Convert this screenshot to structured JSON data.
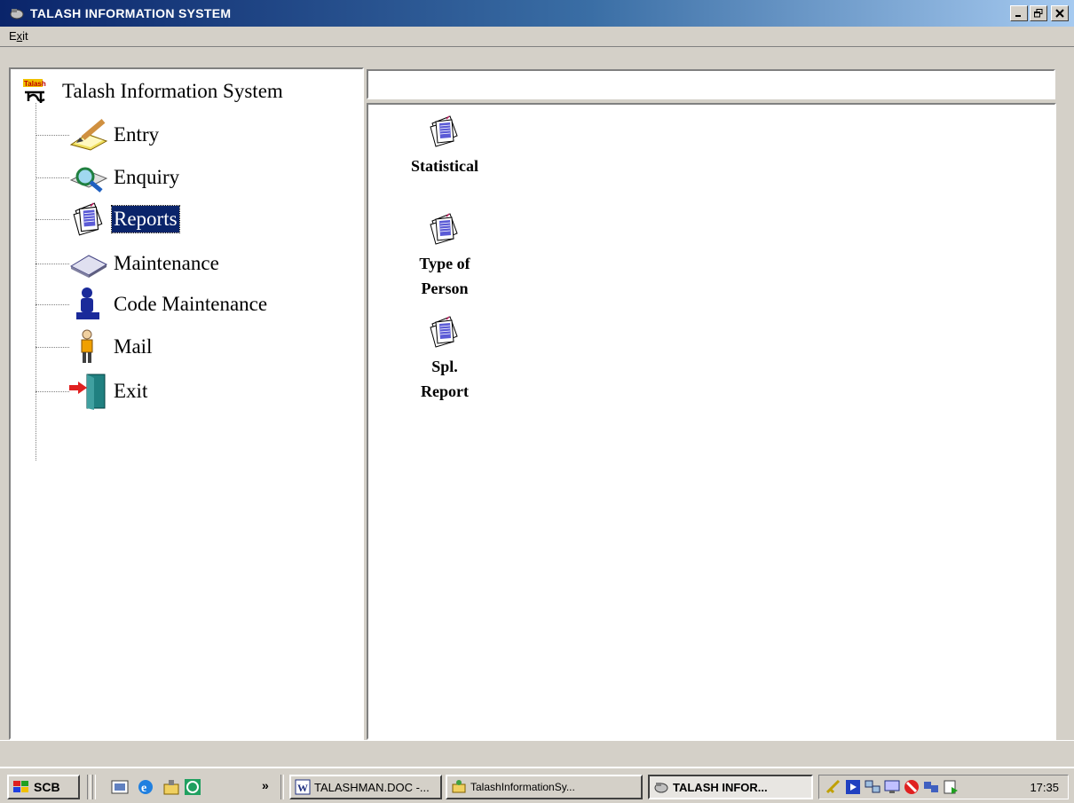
{
  "window": {
    "title": "TALASH INFORMATION SYSTEM",
    "minimize_glyph": "_",
    "maximize_glyph": "□",
    "close_glyph": "×"
  },
  "menu": {
    "exit_label_pre": "E",
    "exit_label_ul": "x",
    "exit_label_post": "it"
  },
  "tree": {
    "root_label": "Talash Information System",
    "items": [
      {
        "label": "Entry",
        "icon": "pencil-notepad-icon"
      },
      {
        "label": "Enquiry",
        "icon": "magnifier-icon"
      },
      {
        "label": "Reports",
        "icon": "report-pages-icon",
        "selected": true
      },
      {
        "label": "Maintenance",
        "icon": "diamond-icon"
      },
      {
        "label": "Code Maintenance",
        "icon": "user-stand-icon"
      },
      {
        "label": "Mail",
        "icon": "person-mailbox-icon"
      },
      {
        "label": "Exit",
        "icon": "exit-door-icon"
      }
    ]
  },
  "path_bar": {
    "value": ""
  },
  "list": {
    "items": [
      {
        "label_line1": "Statistical",
        "label_line2": "",
        "icon": "report-pages-icon"
      },
      {
        "label_line1": "Type of",
        "label_line2": "Person",
        "icon": "report-pages-icon"
      },
      {
        "label_line1": "Spl.",
        "label_line2": "Report",
        "icon": "report-pages-icon"
      }
    ]
  },
  "taskbar": {
    "start_label": "SCB",
    "chevron": "»",
    "tasks": [
      {
        "label": "TALASHMAN.DOC -...",
        "icon": "word-doc-icon",
        "active": false
      },
      {
        "label": "TalashInformationSy...",
        "icon": "folder-network-icon",
        "active": false
      },
      {
        "label": "TALASH INFOR...",
        "icon": "app-icon",
        "active": true
      }
    ],
    "clock": "17:35"
  },
  "colors": {
    "selection": "#0a246a",
    "titlebar": "#0a246a",
    "face": "#d4d0c8"
  }
}
